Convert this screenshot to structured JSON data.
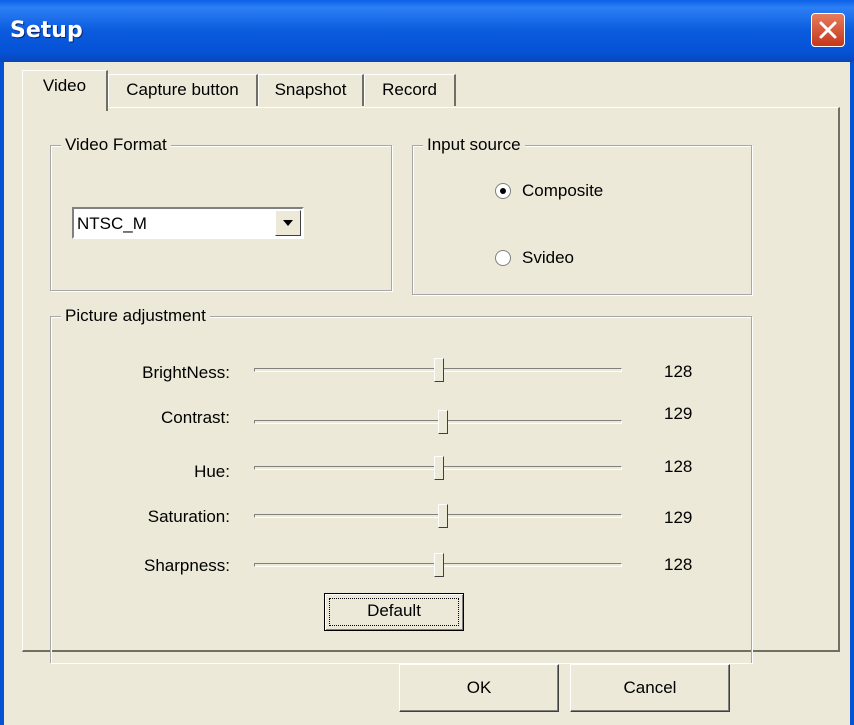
{
  "window": {
    "title": "Setup"
  },
  "tabs": [
    "Video",
    "Capture button",
    "Snapshot",
    "Record"
  ],
  "video_format": {
    "legend": "Video Format",
    "selected": "NTSC_M"
  },
  "input_source": {
    "legend": "Input source",
    "options": [
      "Composite",
      "Svideo"
    ],
    "selected": "Composite"
  },
  "picture": {
    "legend": "Picture adjustment",
    "sliders": [
      {
        "label": "BrightNess:",
        "value": "128",
        "fraction": 0.5
      },
      {
        "label": "Contrast:",
        "value": "129",
        "fraction": 0.51
      },
      {
        "label": "Hue:",
        "value": "128",
        "fraction": 0.5
      },
      {
        "label": "Saturation:",
        "value": "129",
        "fraction": 0.51
      },
      {
        "label": "Sharpness:",
        "value": "128",
        "fraction": 0.5
      }
    ],
    "default_label": "Default"
  },
  "footer": {
    "ok_label": "OK",
    "cancel_label": "Cancel"
  },
  "colors": {
    "titlebar": "#0553d2",
    "face": "#ece9d8",
    "close": "#c4371b"
  }
}
